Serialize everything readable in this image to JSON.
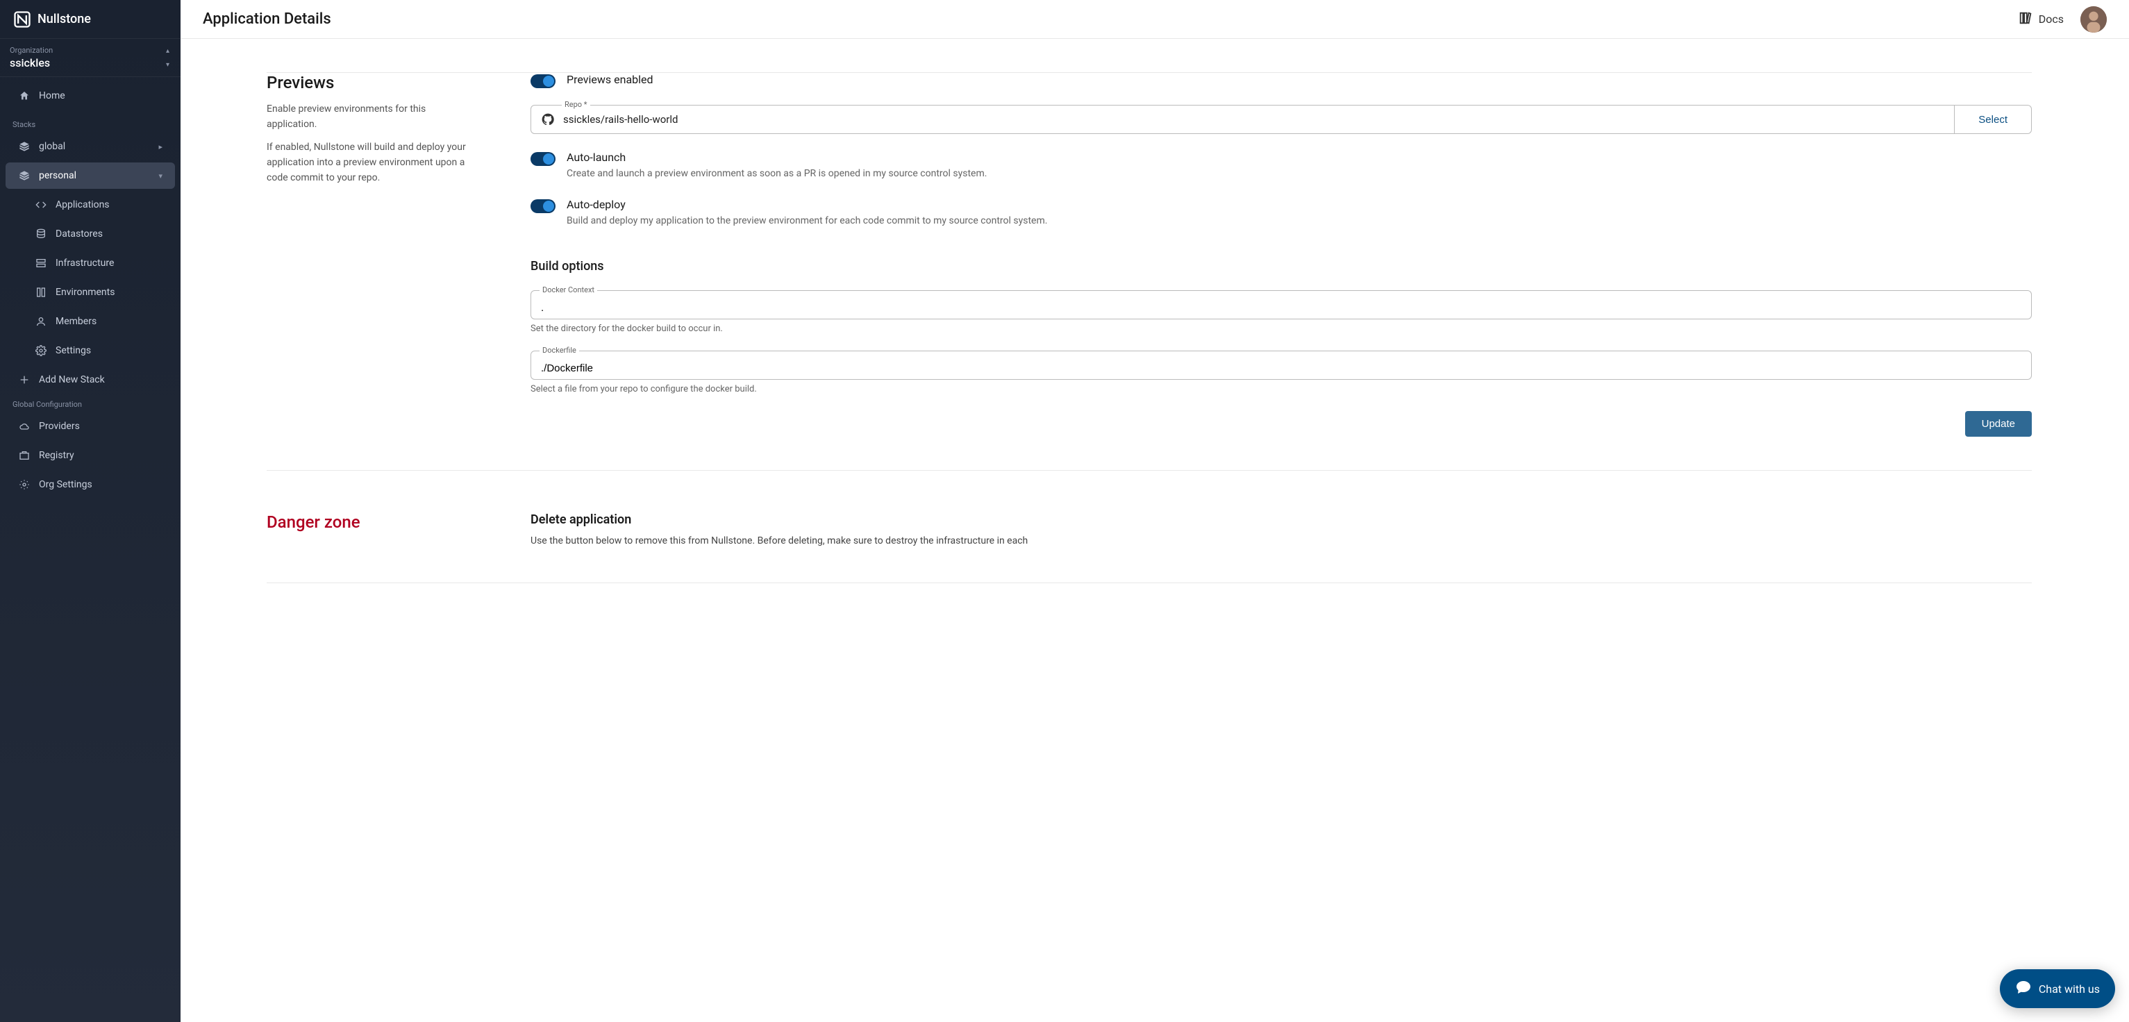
{
  "brand": {
    "name": "Nullstone"
  },
  "org_picker": {
    "label": "Organization",
    "value": "ssickles"
  },
  "sidebar": {
    "home": "Home",
    "stacks_label": "Stacks",
    "global": "global",
    "personal": "personal",
    "sub": {
      "applications": "Applications",
      "datastores": "Datastores",
      "infrastructure": "Infrastructure",
      "environments": "Environments",
      "members": "Members",
      "settings": "Settings"
    },
    "add_stack": "Add New Stack",
    "global_config_label": "Global Configuration",
    "providers": "Providers",
    "registry": "Registry",
    "org_settings": "Org Settings"
  },
  "topbar": {
    "title": "Application Details",
    "docs": "Docs"
  },
  "previews": {
    "title": "Previews",
    "desc1": "Enable preview environments for this application.",
    "desc2": "If enabled, Nullstone will build and deploy your application into a preview environment upon a code commit to your repo.",
    "toggle_label": "Previews enabled",
    "repo_label": "Repo *",
    "repo_value": "ssickles/rails-hello-world",
    "repo_select": "Select",
    "auto_launch_title": "Auto-launch",
    "auto_launch_desc": "Create and launch a preview environment as soon as a PR is opened in my source control system.",
    "auto_deploy_title": "Auto-deploy",
    "auto_deploy_desc": "Build and deploy my application to the preview environment for each code commit to my source control system.",
    "build_options": "Build options",
    "docker_context_label": "Docker Context",
    "docker_context_value": ".",
    "docker_context_help": "Set the directory for the docker build to occur in.",
    "dockerfile_label": "Dockerfile",
    "dockerfile_value": "./Dockerfile",
    "dockerfile_help": "Select a file from your repo to configure the docker build.",
    "update_btn": "Update"
  },
  "danger": {
    "title": "Danger zone",
    "delete_title": "Delete application",
    "delete_desc": "Use the button below to remove this from Nullstone. Before deleting, make sure to destroy the infrastructure in each"
  },
  "chat": {
    "label": "Chat with us"
  }
}
